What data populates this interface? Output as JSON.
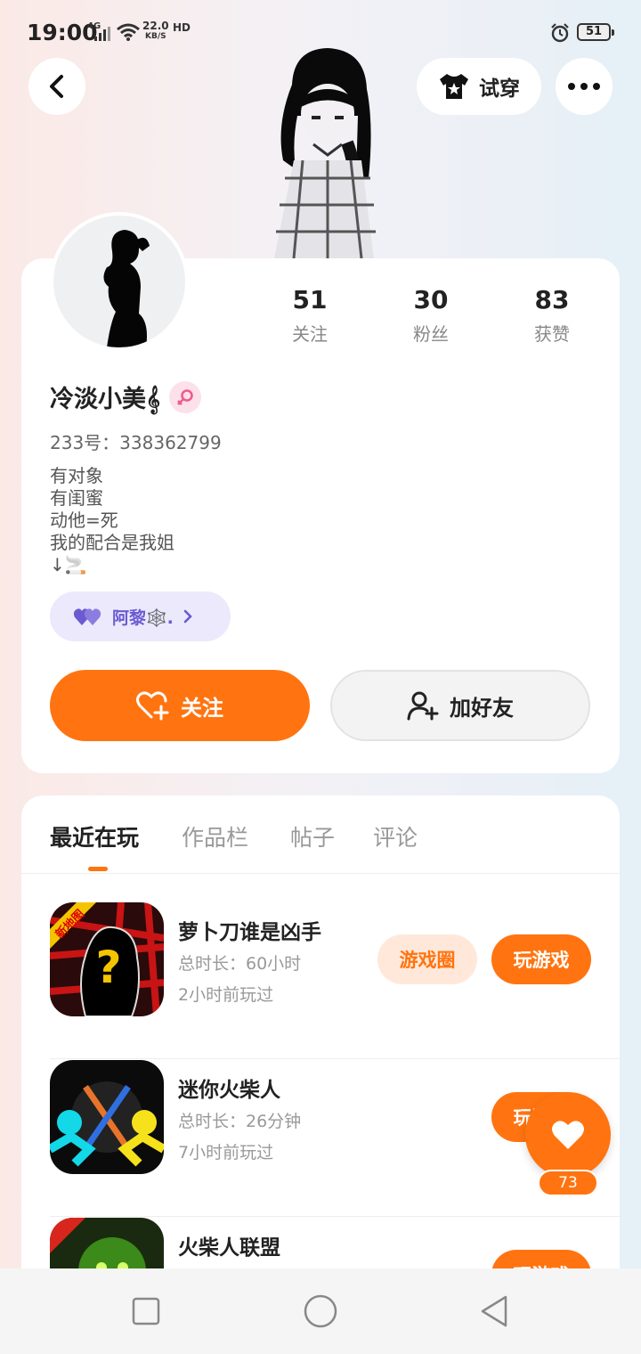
{
  "status_bar": {
    "time": "19:00",
    "network": "4G",
    "speed_value": "22.0",
    "speed_unit": "KB/S",
    "hd": "HD",
    "battery": "51"
  },
  "header": {
    "tryon_label": "试穿"
  },
  "profile": {
    "stats": [
      {
        "value": "51",
        "label": "关注"
      },
      {
        "value": "30",
        "label": "粉丝"
      },
      {
        "value": "83",
        "label": "获赞"
      }
    ],
    "nickname": "冷淡小美𝄞",
    "uid": "233号：338362799",
    "bio": "有对象\n有闺蜜\n动他=死\n我的配合是我姐\n↓🚬",
    "cp_name": "阿黎🕸️.",
    "follow_label": "关注",
    "add_friend_label": "加好友"
  },
  "tabs": [
    "最近在玩",
    "作品栏",
    "帖子",
    "评论"
  ],
  "games": [
    {
      "name": "萝卜刀谁是凶手",
      "duration": "总时长：60小时",
      "last_played": "2小时前玩过",
      "badge": "新地图",
      "circle_label": "游戏圈",
      "play_label": "玩游戏"
    },
    {
      "name": "迷你火柴人",
      "duration": "总时长：26分钟",
      "last_played": "7小时前玩过",
      "play_label": "玩游戏"
    },
    {
      "name": "火柴人联盟",
      "play_label": "玩游戏"
    }
  ],
  "like_count": "73",
  "colors": {
    "accent": "#ff7410",
    "cp_pill": "#ebe9fb"
  }
}
